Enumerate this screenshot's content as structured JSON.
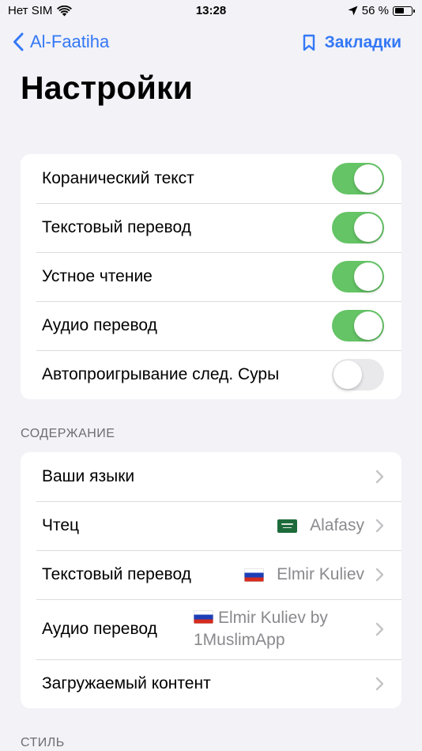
{
  "status_bar": {
    "carrier": "Нет SIM",
    "time": "13:28",
    "battery_percent": "56 %",
    "battery_level": 0.56
  },
  "nav": {
    "back_label": "Al-Faatiha",
    "bookmarks_label": "Закладки"
  },
  "title": "Настройки",
  "toggles": [
    {
      "label": "Коранический текст",
      "on": true
    },
    {
      "label": "Текстовый перевод",
      "on": true
    },
    {
      "label": "Устное чтение",
      "on": true
    },
    {
      "label": "Аудио перевод",
      "on": true
    },
    {
      "label": "Автопроигрывание след. Суры",
      "on": false
    }
  ],
  "content_section": {
    "header": "СОДЕРЖАНИЕ",
    "rows": [
      {
        "label": "Ваши языки",
        "value": ""
      },
      {
        "label": "Чтец",
        "value": "Alafasy",
        "flag": "saudi-arabia-flag"
      },
      {
        "label": "Текстовый перевод",
        "value": "Elmir Kuliev",
        "flag": "russia-flag"
      },
      {
        "label": "Аудио перевод",
        "value": "Elmir Kuliev by 1MuslimApp",
        "flag": "russia-flag"
      },
      {
        "label": "Загружаемый контент",
        "value": ""
      }
    ]
  },
  "style_section": {
    "header": "СТИЛЬ"
  },
  "colors": {
    "accent": "#3478f6",
    "toggle_on": "#65c466",
    "toggle_off": "#e9e9eb",
    "background": "#f2f2f7",
    "secondary_text": "#8a8a8e"
  }
}
